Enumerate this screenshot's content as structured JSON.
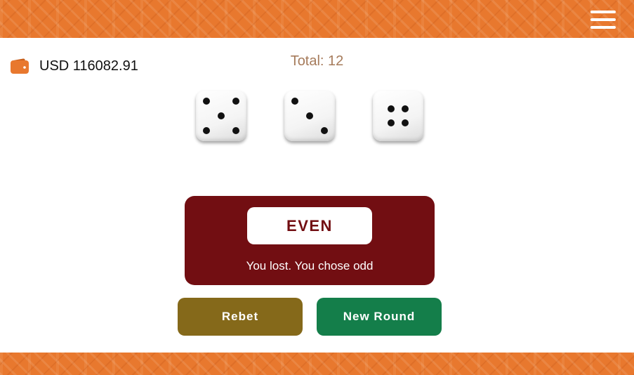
{
  "header": {
    "menu_icon": "hamburger-menu-icon"
  },
  "wallet": {
    "icon": "wallet-icon",
    "currency": "USD",
    "amount": "116082.91",
    "balance_text": "USD 116082.91"
  },
  "game": {
    "total_text": "Total: 12",
    "dice": [
      5,
      3,
      4
    ]
  },
  "result": {
    "outcome": "EVEN",
    "message": "You lost. You chose odd"
  },
  "actions": {
    "rebet_label": "Rebet",
    "new_round_label": "New Round"
  },
  "colors": {
    "brand_orange": "#e8782e",
    "result_panel": "#720e12",
    "rebet_button": "#85691a",
    "new_round_button": "#147e4a",
    "total_text": "#a67b5b"
  }
}
